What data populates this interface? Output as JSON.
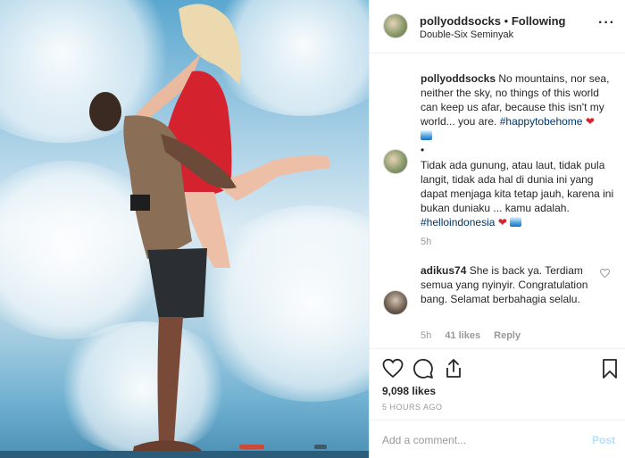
{
  "post": {
    "username": "pollyoddsocks",
    "follow_status": "Following",
    "location": "Double-Six Seminyak"
  },
  "comments": [
    {
      "username": "pollyoddsocks",
      "text": "No mountains, nor sea, neither the sky, no things of this world can keep us afar, because this isn't my world... you are.",
      "hashtag": "#happytobehome",
      "emojis": [
        "heart",
        "wave"
      ]
    },
    {
      "prefix": "•",
      "text": "Tidak ada gunung, atau laut, tidak pula langit, tidak ada hal di dunia ini yang dapat menjaga kita tetap jauh, karena ini bukan duniaku ... kamu adalah.",
      "hashtag": "#helloindonesia",
      "emojis": [
        "heart",
        "wave"
      ],
      "time": "5h"
    },
    {
      "username": "adikus74",
      "text": "She is back ya. Terdiam semua yang nyinyir. Congratulation bang. Selamat berbahagia selalu.",
      "time": "5h",
      "likes": "41 likes",
      "reply_label": "Reply"
    }
  ],
  "actions": {
    "like_icon": "heart-icon",
    "comment_icon": "comment-icon",
    "share_icon": "share-icon",
    "save_icon": "bookmark-icon"
  },
  "likes_count": "9,098 likes",
  "posted_ago": "5 HOURS AGO",
  "add_comment": {
    "placeholder": "Add a comment...",
    "post_label": "Post"
  },
  "colors": {
    "hashtag": "#003569",
    "heart": "#d8232a",
    "muted": "#999999",
    "post_button": "#b2dffc"
  }
}
